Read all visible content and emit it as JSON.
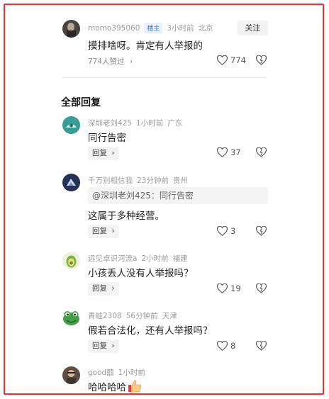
{
  "top_comment": {
    "username": "momo395060",
    "badge": "楼主",
    "time": "3小时前",
    "location": "北京",
    "follow_label": "关注",
    "content": "摸排啥呀。肯定有人举报的",
    "likes_link": "774人赞过",
    "like_count": "774"
  },
  "section_title": "全部回复",
  "replies": [
    {
      "username": "深圳老刘425",
      "time": "1小时前",
      "location": "广东",
      "content": "同行告密",
      "reply_label": "回复",
      "like_count": "37"
    },
    {
      "username": "千万别相信我",
      "time": "23分钟前",
      "location": "贵州",
      "quote": "@深圳老刘425：同行告密",
      "content": "这属于多种经营。",
      "reply_label": "回复",
      "like_count": "3"
    },
    {
      "username": "远见卓识河流a",
      "time": "2小时前",
      "location": "福建",
      "content": "小孩丢人没有人举报吗？",
      "reply_label": "回复",
      "like_count": "19"
    },
    {
      "username": "青蛙2308",
      "time": "56分钟前",
      "location": "天津",
      "content": "假若合法化，还有人举报吗？",
      "reply_label": "回复",
      "like_count": "8"
    },
    {
      "username": "good囍",
      "time": "1小时前",
      "content": "哈哈哈哈"
    }
  ],
  "colors": {
    "frame": "#e8322b",
    "badge_text": "#3b7bd6"
  }
}
